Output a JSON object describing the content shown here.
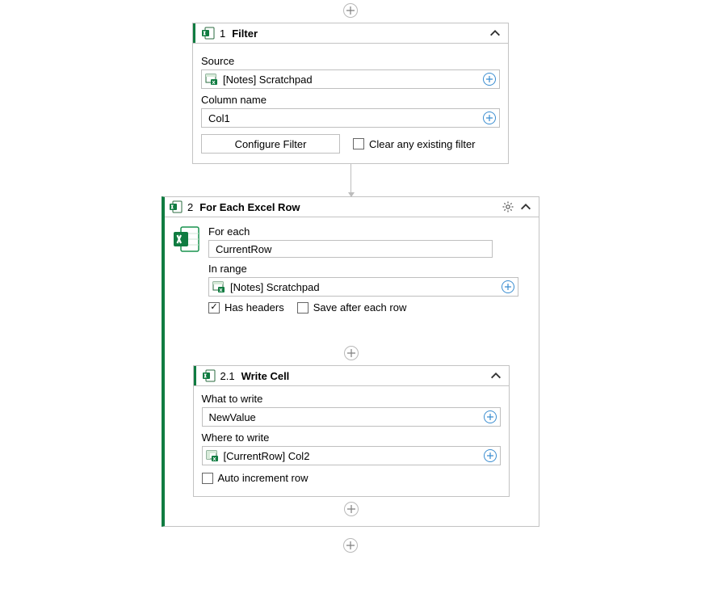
{
  "filter": {
    "index": "1",
    "title": "Filter",
    "source_label": "Source",
    "source_value": "[Notes] Scratchpad",
    "column_label": "Column name",
    "column_value": "Col1",
    "configure_btn": "Configure Filter",
    "clear_checkbox": "Clear any existing filter",
    "clear_checked": false
  },
  "foreach": {
    "index": "2",
    "title": "For Each Excel Row",
    "foreach_label": "For each",
    "foreach_value": "CurrentRow",
    "inrange_label": "In range",
    "inrange_value": "[Notes] Scratchpad",
    "has_headers_label": "Has headers",
    "has_headers_checked": true,
    "save_after_label": "Save after each row",
    "save_after_checked": false
  },
  "writecell": {
    "index": "2.1",
    "title": "Write Cell",
    "what_label": "What to write",
    "what_value": "NewValue",
    "where_label": "Where to write",
    "where_value": "[CurrentRow] Col2",
    "autoinc_label": "Auto increment row",
    "autoinc_checked": false
  }
}
